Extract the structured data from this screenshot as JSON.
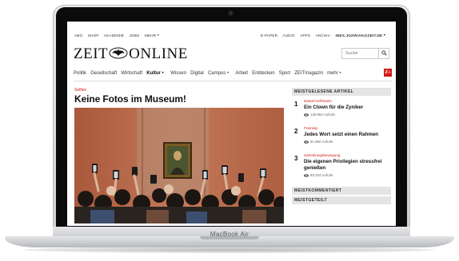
{
  "device": {
    "label": "MacBook Air"
  },
  "topbar": {
    "left": [
      "ABO",
      "SHOP",
      "AKADEMIE",
      "JOBS",
      "MEHR"
    ],
    "right": [
      "E-PAPER",
      "AUDIO",
      "APPS",
      "ARCHIV"
    ],
    "user": "INES.JOZWIAK@ZEIT.DE"
  },
  "logo": {
    "left": "ZEIT",
    "right": "ONLINE"
  },
  "search": {
    "placeholder": "Suche"
  },
  "nav": {
    "items": [
      "Politik",
      "Gesellschaft",
      "Wirtschaft",
      "Kultur",
      "Wissen",
      "Digital",
      "Campus",
      "Arbeit",
      "Entdecken",
      "Sport",
      "ZEITmagazin",
      "mehr"
    ],
    "active": "Kultur",
    "z_button": "Z+"
  },
  "article": {
    "kicker": "Selfies",
    "headline": "Keine Fotos im Museum!"
  },
  "sidebar": {
    "most_read_title": "MEISTGELESENE ARTIKEL",
    "items": [
      {
        "rank": "1",
        "kicker": "Daniel Kehlmann",
        "title": "Ein Clown für die Zyniker",
        "views": "129.984 Aufrufe"
      },
      {
        "rank": "2",
        "kicker": "Framing",
        "title": "Jedes Wort setzt einen Rahmen",
        "views": "91.950 Aufrufe"
      },
      {
        "rank": "3",
        "kicker": "Sammlungsbewegung",
        "title": "Die eigenen Privilegien stressfrei genießen",
        "views": "60.204 Aufrufe"
      }
    ],
    "most_commented_title": "MEISTKOMMENTIERT",
    "most_shared_title": "MEISTGETEILT"
  },
  "colors": {
    "accent": "#d11a14",
    "museum_wall": "#b96c4d"
  }
}
